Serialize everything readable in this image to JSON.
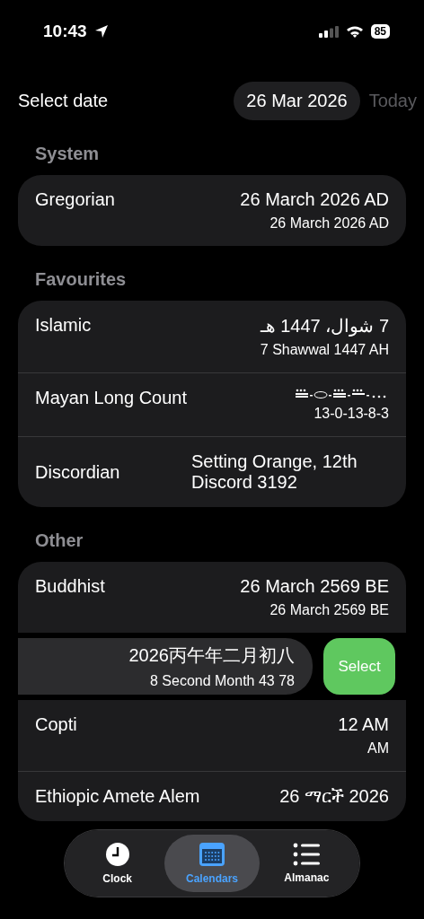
{
  "status_bar": {
    "time": "10:43",
    "battery": "85"
  },
  "header": {
    "label": "Select date",
    "date": "26 Mar 2026",
    "today": "Today"
  },
  "sections": [
    {
      "title": "System",
      "rows": [
        {
          "kind": "standard",
          "name": "Gregorian",
          "value": "26 March 2026 AD",
          "subvalue": "26 March 2026 AD"
        }
      ]
    },
    {
      "title": "Favourites",
      "rows": [
        {
          "kind": "standard",
          "name": "Islamic",
          "value": "7 شوال، 1447 هـ",
          "subvalue": "7 Shawwal 1447 AH"
        },
        {
          "kind": "glyphs",
          "name": "Mayan Long Count",
          "subvalue": "13-0-13-8-3"
        },
        {
          "kind": "standard",
          "name": "Discordian",
          "value": "Setting Orange, 12th Discord 3192"
        }
      ]
    },
    {
      "title": "Other",
      "rows": [
        {
          "kind": "standard",
          "name": "Buddhist",
          "value": "26 March 2569 BE",
          "subvalue": "26 March 2569 BE"
        },
        {
          "kind": "swiped",
          "value": "2026丙午年二月初八",
          "subvalue": "8 Second Month 43 78",
          "action": "Select"
        },
        {
          "kind": "standard",
          "name": "Copti",
          "value": "12 AM",
          "subvalue": "AM"
        },
        {
          "kind": "standard",
          "name": "Ethiopic Amete Alem",
          "value": "26 ማርች 2026"
        }
      ]
    }
  ],
  "tabs": [
    {
      "kind": "clock",
      "label": "Clock",
      "selected": false
    },
    {
      "kind": "calendar",
      "label": "Calendars",
      "selected": true
    },
    {
      "kind": "list",
      "label": "Almanac",
      "selected": false
    }
  ]
}
